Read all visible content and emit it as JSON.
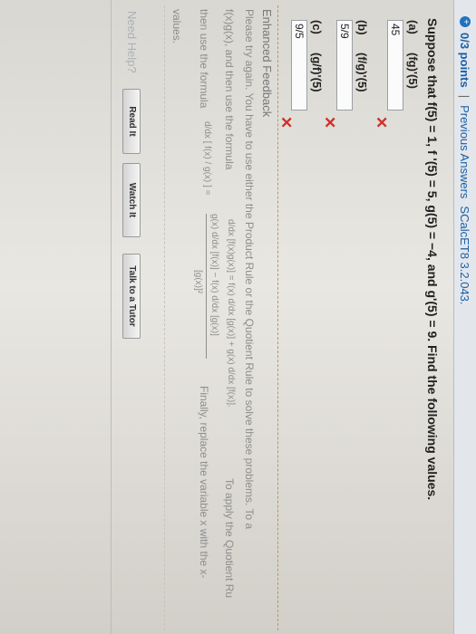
{
  "header": {
    "icon": "plus-circle-icon",
    "points": "0/3 points",
    "separator": "|",
    "previous": "Previous Answers",
    "course": "SCalcET8 3.2.043."
  },
  "question": {
    "text": "Suppose that f(5) = 1, f '(5) = 5, g(5) = −4, and g'(5) = 9.  Find the following values."
  },
  "parts": [
    {
      "label": "(a)",
      "expr": "(fg)'(5)",
      "answer": "45",
      "status": "incorrect"
    },
    {
      "label": "(b)",
      "expr": "(f/g)'(5)",
      "answer": "5/9",
      "status": "incorrect"
    },
    {
      "label": "(c)",
      "expr": "(g/f)'(5)",
      "answer": "9/5",
      "status": "incorrect"
    }
  ],
  "feedback": {
    "title": "Enhanced Feedback",
    "line1": "Please try again. You have to use either the Product Rule or the Quotient Rule to solve these problems. To a",
    "line2_start": "f(x)g(x),  and then use the formula",
    "product_formula": "d/dx [f(x)g(x)] = f(x) d/dx [g(x)] + g(x) d/dx [f(x)].",
    "line2_end": "To apply the Quotient Ru",
    "line3_start": "then use the formula",
    "quotient_lhs": "d/dx [ f(x) / g(x) ] =",
    "quotient_num": "g(x) d/dx [f(x)] − f(x) d/dx [g(x)]",
    "quotient_den": "[g(x)]²",
    "line3_end": "Finally, replace the variable x with the x-",
    "line4": "values."
  },
  "help": {
    "label": "Need Help?",
    "buttons": [
      "Read It",
      "Watch It",
      "Talk to a Tutor"
    ]
  }
}
